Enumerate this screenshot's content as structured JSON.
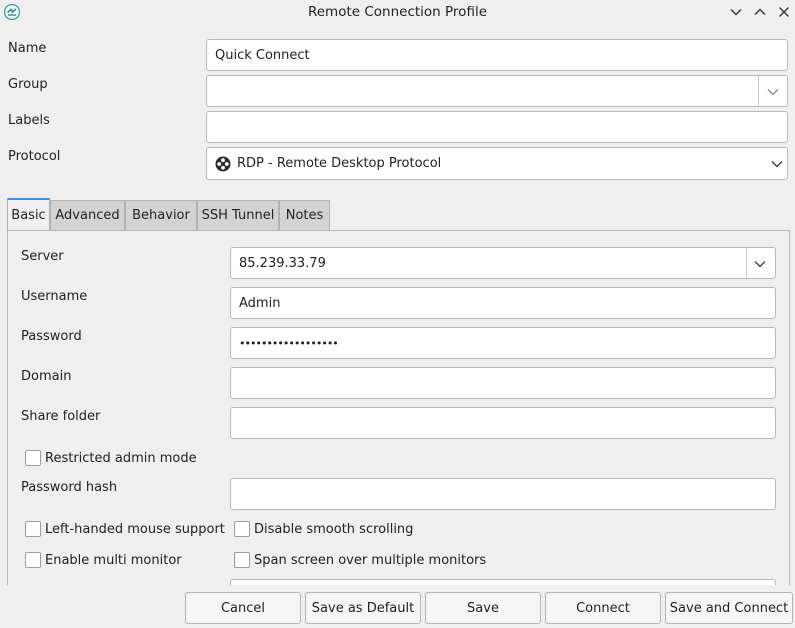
{
  "window": {
    "title": "Remote Connection Profile",
    "app_icon": "remmina-icon",
    "controls": [
      "chevron-down-icon",
      "chevron-up-icon",
      "close-icon"
    ]
  },
  "profile": {
    "name_label": "Name",
    "name_value": "Quick Connect",
    "group_label": "Group",
    "group_value": "",
    "labels_label": "Labels",
    "labels_value": "",
    "protocol_label": "Protocol",
    "protocol_value": "RDP - Remote Desktop Protocol"
  },
  "tabs": [
    {
      "label": "Basic",
      "active": true
    },
    {
      "label": "Advanced",
      "active": false
    },
    {
      "label": "Behavior",
      "active": false
    },
    {
      "label": "SSH Tunnel",
      "active": false
    },
    {
      "label": "Notes",
      "active": false
    }
  ],
  "basic": {
    "server_label": "Server",
    "server_value": "85.239.33.79",
    "username_label": "Username",
    "username_value": "Admin",
    "password_label": "Password",
    "password_value": "••••••••••••••••••",
    "domain_label": "Domain",
    "domain_value": "",
    "share_label": "Share folder",
    "share_value": "",
    "restricted_admin": "Restricted admin mode",
    "password_hash_label": "Password hash",
    "password_hash_value": "",
    "left_handed": "Left-handed mouse support",
    "disable_smooth": "Disable smooth scrolling",
    "multi_monitor": "Enable multi monitor",
    "span_screen": "Span screen over multiple monitors"
  },
  "buttons": {
    "cancel": "Cancel",
    "save_default": "Save as Default",
    "save": "Save",
    "connect": "Connect",
    "save_connect": "Save and Connect"
  },
  "colors": {
    "accent": "#3d8ee0",
    "window_bg": "#efefef",
    "field_bg": "#ffffff"
  }
}
